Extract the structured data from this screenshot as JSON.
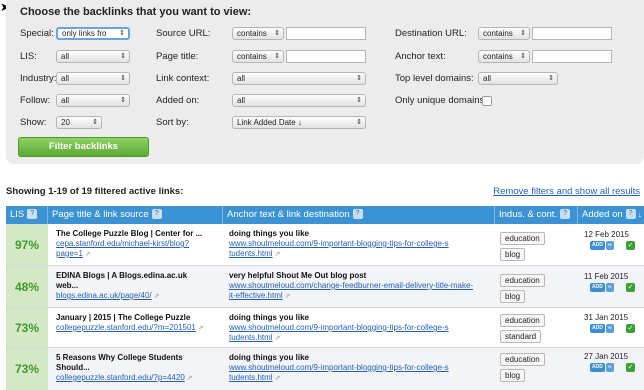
{
  "panel": {
    "title": "Choose the backlinks that you want to view:",
    "filter_button": "Filter backlinks",
    "filters": {
      "special": {
        "label": "Special:",
        "value": "only links fro"
      },
      "lis": {
        "label": "LIS:",
        "value": "all"
      },
      "industry": {
        "label": "Industry:",
        "value": "all"
      },
      "follow": {
        "label": "Follow:",
        "value": "all"
      },
      "show": {
        "label": "Show:",
        "value": "20"
      },
      "source_url": {
        "label": "Source URL:",
        "op": "contains",
        "value": ""
      },
      "page_title": {
        "label": "Page title:",
        "op": "contains",
        "value": ""
      },
      "link_context": {
        "label": "Link context:",
        "value": "all"
      },
      "added_on": {
        "label": "Added on:",
        "value": "all"
      },
      "sort_by": {
        "label": "Sort by:",
        "value": "Link Added Date ↓"
      },
      "destination_url": {
        "label": "Destination URL:",
        "op": "contains",
        "value": ""
      },
      "anchor_text": {
        "label": "Anchor text:",
        "op": "contains",
        "value": ""
      },
      "top_level_domains": {
        "label": "Top level domains:",
        "value": "all"
      },
      "unique_domains": {
        "label": "Only unique domains:",
        "checked": false
      }
    }
  },
  "results": {
    "count_text": "Showing 1-19 of 19 filtered active links:",
    "remove_filters": "Remove filters and show all results"
  },
  "table": {
    "headers": {
      "lis": "LIS",
      "page": "Page title & link source",
      "anchor": "Anchor text & link destination",
      "indus": "Indus. & cont.",
      "added": "Added on"
    },
    "help": "?",
    "sort_icon": "↓",
    "rows": [
      {
        "lis": "97%",
        "title": "The College Puzzle Blog | Center for ...",
        "source": [
          "cepa.stanford.edu/michael-kirst/blog?",
          "page=1"
        ],
        "anchor": "doing things you like",
        "dest": [
          "www.shoutmeloud.com/9-important-blogging-tips-for-college-s",
          "tudents.html"
        ],
        "tags": [
          "education",
          "blog"
        ],
        "date": "12 Feb 2015"
      },
      {
        "lis": "48%",
        "title": "EDINA Blogs | A Blogs.edina.ac.uk",
        "title2": "web...",
        "source": [
          "blogs.edina.ac.uk/page/40/"
        ],
        "anchor": "very helpful Shout Me Out blog post",
        "dest": [
          "www.shoutmeloud.com/change-feedburner-email-delivery-title-make-",
          "it-effective.html"
        ],
        "tags": [
          "education",
          "blog"
        ],
        "date": "11 Feb 2015"
      },
      {
        "lis": "73%",
        "title": "January | 2015 | The College Puzzle",
        "source": [
          "collegepuzzle.stanford.edu/?m=201501"
        ],
        "anchor": "doing things you like",
        "dest": [
          "www.shoutmeloud.com/9-important-blogging-tips-for-college-s",
          "tudents.html"
        ],
        "tags": [
          "education",
          "standard"
        ],
        "date": "31 Jan 2015"
      },
      {
        "lis": "73%",
        "title": "5 Reasons Why College Students",
        "title2": "Should...",
        "source": [
          "collegepuzzle.stanford.edu/?p=4420"
        ],
        "anchor": "doing things you like",
        "dest": [
          "www.shoutmeloud.com/9-important-blogging-tips-for-college-s",
          "tudents.html"
        ],
        "tags": [
          "education",
          "blog"
        ],
        "date": "27 Jan 2015"
      }
    ],
    "badge_add": "ADD",
    "badge_link": "∞",
    "check": "✓",
    "ext": "⇗",
    "select_arrow": "⇕"
  },
  "colors": {
    "accent": "#3b93d3",
    "filter_button": "#6dbb45",
    "lis_text": "#3f9a2a",
    "link": "#2560b8"
  }
}
